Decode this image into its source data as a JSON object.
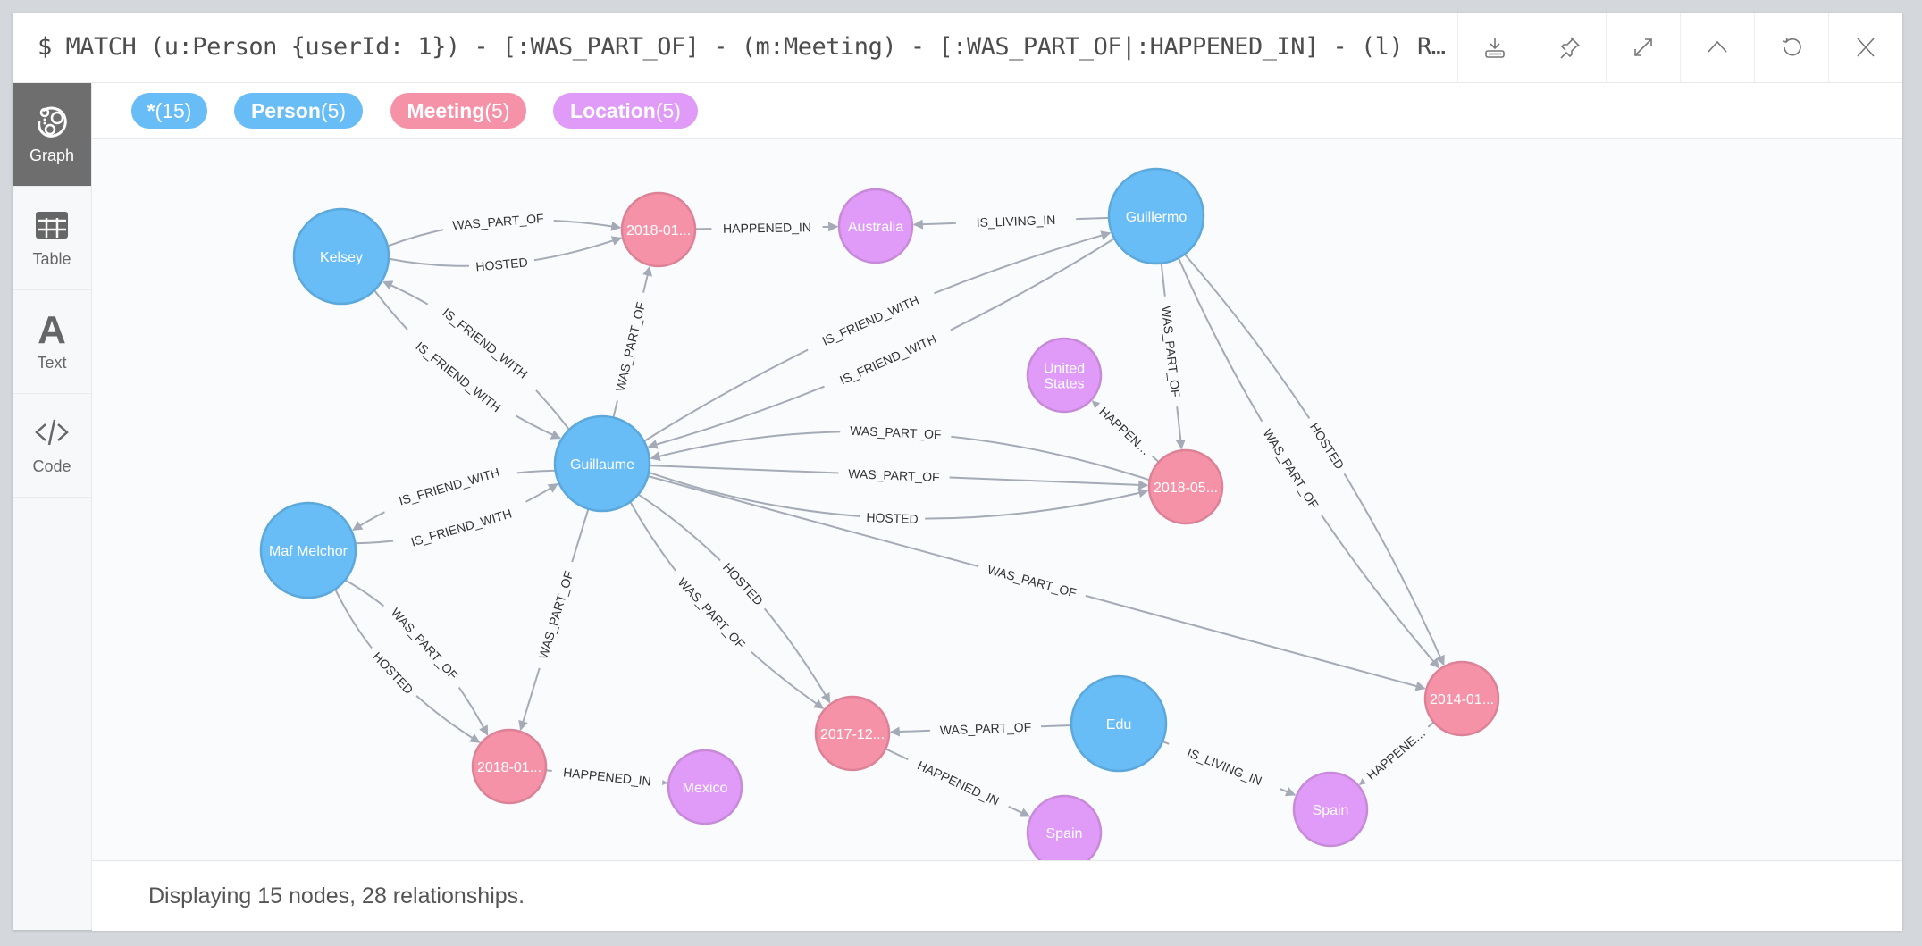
{
  "query": "$ MATCH (u:Person {userId: 1}) - [:WAS_PART_OF] - (m:Meeting) - [:WAS_PART_OF|:HAPPENED_IN] - (l) R…",
  "toolbar": [
    {
      "name": "download",
      "icon": "download-icon"
    },
    {
      "name": "pin",
      "icon": "pin-icon"
    },
    {
      "name": "fullscreen",
      "icon": "expand-icon"
    },
    {
      "name": "collapse",
      "icon": "chevron-up-icon"
    },
    {
      "name": "rerun",
      "icon": "refresh-icon"
    },
    {
      "name": "close",
      "icon": "close-icon"
    }
  ],
  "sidebar": {
    "items": [
      {
        "label": "Graph",
        "icon": "graph-icon",
        "active": true
      },
      {
        "label": "Table",
        "icon": "table-icon",
        "active": false
      },
      {
        "label": "Text",
        "icon": "text-icon",
        "active": false
      },
      {
        "label": "Code",
        "icon": "code-icon",
        "active": false
      }
    ]
  },
  "labels": [
    {
      "name": "*",
      "count": "(15)",
      "color": "#68bdf6"
    },
    {
      "name": "Person",
      "count": "(5)",
      "color": "#68bdf6"
    },
    {
      "name": "Meeting",
      "count": "(5)",
      "color": "#f692a8"
    },
    {
      "name": "Location",
      "count": "(5)",
      "color": "#df9bf7"
    }
  ],
  "colors": {
    "Person": {
      "fill": "#68bdf6",
      "stroke": "#5ca8db"
    },
    "Meeting": {
      "fill": "#f692a8",
      "stroke": "#dc8196"
    },
    "Location": {
      "fill": "#df9bf7",
      "stroke": "#c78ad9"
    },
    "edge": "#a5abb6",
    "edgeText": "#333333"
  },
  "graph": {
    "nodes": [
      {
        "id": "kelsey",
        "label": "Person",
        "caption": "Kelsey"
      },
      {
        "id": "m_2018_01_a",
        "label": "Meeting",
        "caption": "2018-01..."
      },
      {
        "id": "australia",
        "label": "Location",
        "caption": "Australia"
      },
      {
        "id": "guillermo",
        "label": "Person",
        "caption": "Guillermo"
      },
      {
        "id": "us",
        "label": "Location",
        "caption": "United States"
      },
      {
        "id": "guillaume",
        "label": "Person",
        "caption": "Guillaume"
      },
      {
        "id": "m_2018_05",
        "label": "Meeting",
        "caption": "2018-05..."
      },
      {
        "id": "maf",
        "label": "Person",
        "caption": "Maf Melchor"
      },
      {
        "id": "m_2014_01",
        "label": "Meeting",
        "caption": "2014-01..."
      },
      {
        "id": "m_2017_12",
        "label": "Meeting",
        "caption": "2017-12..."
      },
      {
        "id": "edu",
        "label": "Person",
        "caption": "Edu"
      },
      {
        "id": "m_2018_01_b",
        "label": "Meeting",
        "caption": "2018-01..."
      },
      {
        "id": "mexico",
        "label": "Location",
        "caption": "Mexico"
      },
      {
        "id": "spain_a",
        "label": "Location",
        "caption": "Spain"
      },
      {
        "id": "spain_b",
        "label": "Location",
        "caption": "Spain"
      }
    ],
    "relationships": [
      {
        "from": "kelsey",
        "to": "m_2018_01_a",
        "type": "WAS_PART_OF"
      },
      {
        "from": "kelsey",
        "to": "m_2018_01_a",
        "type": "HOSTED"
      },
      {
        "from": "m_2018_01_a",
        "to": "australia",
        "type": "HAPPENED_IN"
      },
      {
        "from": "guillermo",
        "to": "australia",
        "type": "IS_LIVING_IN"
      },
      {
        "from": "kelsey",
        "to": "guillaume",
        "type": "IS_FRIEND_WITH"
      },
      {
        "from": "guillaume",
        "to": "kelsey",
        "type": "IS_FRIEND_WITH"
      },
      {
        "from": "guillaume",
        "to": "m_2018_01_a",
        "type": "WAS_PART_OF"
      },
      {
        "from": "guillaume",
        "to": "guillermo",
        "type": "IS_FRIEND_WITH"
      },
      {
        "from": "guillermo",
        "to": "guillaume",
        "type": "IS_FRIEND_WITH"
      },
      {
        "from": "guillermo",
        "to": "m_2018_05",
        "type": "WAS_PART_OF"
      },
      {
        "from": "guillermo",
        "to": "m_2014_01",
        "type": "HOSTED"
      },
      {
        "from": "guillermo",
        "to": "m_2014_01",
        "type": "WAS_PART_OF"
      },
      {
        "from": "m_2018_05",
        "to": "us",
        "type": "HAPPENED_IN"
      },
      {
        "from": "m_2018_05",
        "to": "guillaume",
        "type": "WAS_PART_OF"
      },
      {
        "from": "guillaume",
        "to": "m_2018_05",
        "type": "WAS_PART_OF"
      },
      {
        "from": "guillaume",
        "to": "m_2018_05",
        "type": "HOSTED"
      },
      {
        "from": "guillaume",
        "to": "m_2014_01",
        "type": "WAS_PART_OF"
      },
      {
        "from": "maf",
        "to": "guillaume",
        "type": "IS_FRIEND_WITH"
      },
      {
        "from": "guillaume",
        "to": "maf",
        "type": "IS_FRIEND_WITH"
      },
      {
        "from": "guillaume",
        "to": "m_2018_01_b",
        "type": "WAS_PART_OF"
      },
      {
        "from": "guillaume",
        "to": "m_2017_12",
        "type": "HOSTED"
      },
      {
        "from": "guillaume",
        "to": "m_2017_12",
        "type": "WAS_PART_OF"
      },
      {
        "from": "maf",
        "to": "m_2018_01_b",
        "type": "HOSTED"
      },
      {
        "from": "maf",
        "to": "m_2018_01_b",
        "type": "WAS_PART_OF"
      },
      {
        "from": "m_2018_01_b",
        "to": "mexico",
        "type": "HAPPENED_IN"
      },
      {
        "from": "edu",
        "to": "m_2017_12",
        "type": "WAS_PART_OF"
      },
      {
        "from": "m_2017_12",
        "to": "spain_a",
        "type": "HAPPENED_IN"
      },
      {
        "from": "edu",
        "to": "spain_b",
        "type": "IS_LIVING_IN"
      },
      {
        "from": "m_2014_01",
        "to": "spain_b",
        "type": "HAPPENED_IN"
      }
    ]
  },
  "status": "Displaying 15 nodes, 28 relationships."
}
